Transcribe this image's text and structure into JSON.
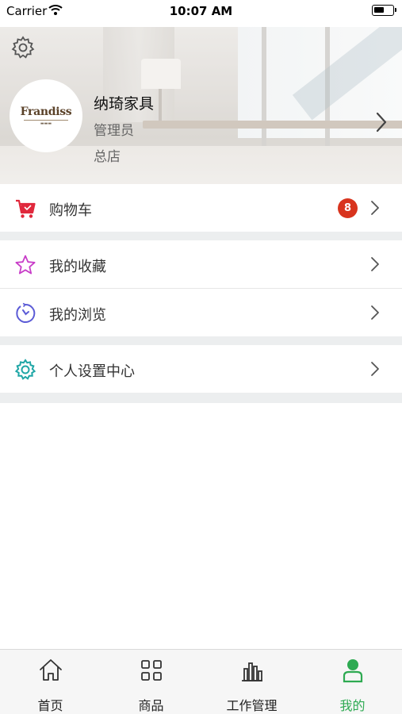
{
  "status_bar": {
    "carrier": "Carrier",
    "time": "10:07 AM",
    "battery_level": 0.55
  },
  "header": {
    "settings_icon": "gear-icon",
    "avatar_brand": "Frandiss",
    "user_name": "纳琦家具",
    "user_role": "管理员",
    "store": "总店",
    "chevron_icon": "chevron-right-icon"
  },
  "menu": {
    "cart": {
      "label": "购物车",
      "badge": "8",
      "icon": "shopping-cart-icon",
      "color": "#e0283c"
    },
    "favorites": {
      "label": "我的收藏",
      "icon": "star-icon",
      "color": "#c83cc8"
    },
    "history": {
      "label": "我的浏览",
      "icon": "clock-icon",
      "color": "#5b5bd6"
    },
    "settings": {
      "label": "个人设置中心",
      "icon": "settings-gear-icon",
      "color": "#1fa6a6"
    }
  },
  "tabs": [
    {
      "label": "首页",
      "icon": "home-icon",
      "active": false
    },
    {
      "label": "商品",
      "icon": "grid-icon",
      "active": false
    },
    {
      "label": "工作管理",
      "icon": "bar-chart-icon",
      "active": false
    },
    {
      "label": "我的",
      "icon": "user-icon",
      "active": true
    }
  ],
  "colors": {
    "accent": "#2eaa52",
    "badge": "#d8341e",
    "separator": "#eceeef"
  }
}
